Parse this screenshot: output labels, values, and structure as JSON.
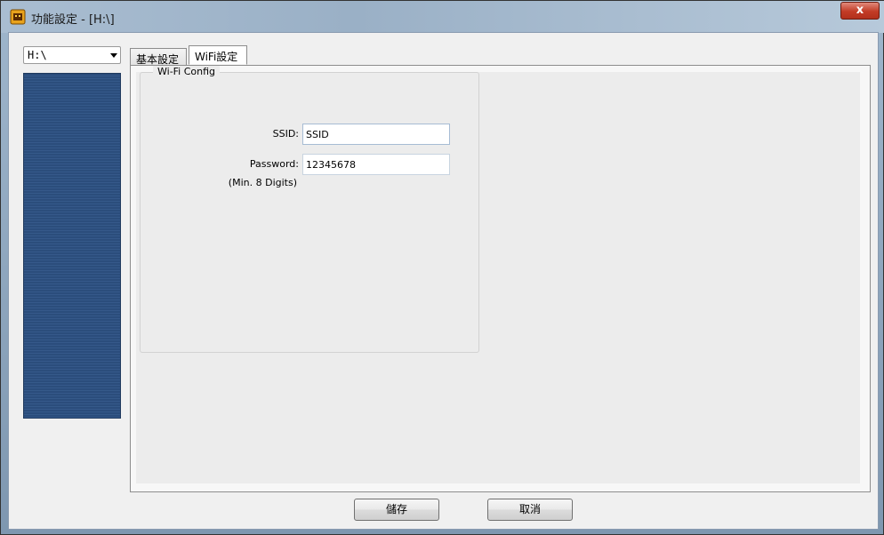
{
  "window": {
    "title": "功能設定 - [H:\\]",
    "close_label": "x"
  },
  "drive_select": {
    "value": "H:\\"
  },
  "tabs": [
    {
      "label": "基本設定",
      "active": false
    },
    {
      "label": "WiFi設定",
      "active": true
    }
  ],
  "wifi_config": {
    "group_title": "Wi-Fi Config",
    "ssid_label": "SSID:",
    "ssid_value": "SSID",
    "password_label": "Password:",
    "password_value": "12345678",
    "password_hint": "(Min. 8 Digits)"
  },
  "buttons": {
    "save": "儲存",
    "cancel": "取消"
  },
  "colors": {
    "side_panel": "#2b4d7c",
    "close_button": "#c23b26"
  }
}
